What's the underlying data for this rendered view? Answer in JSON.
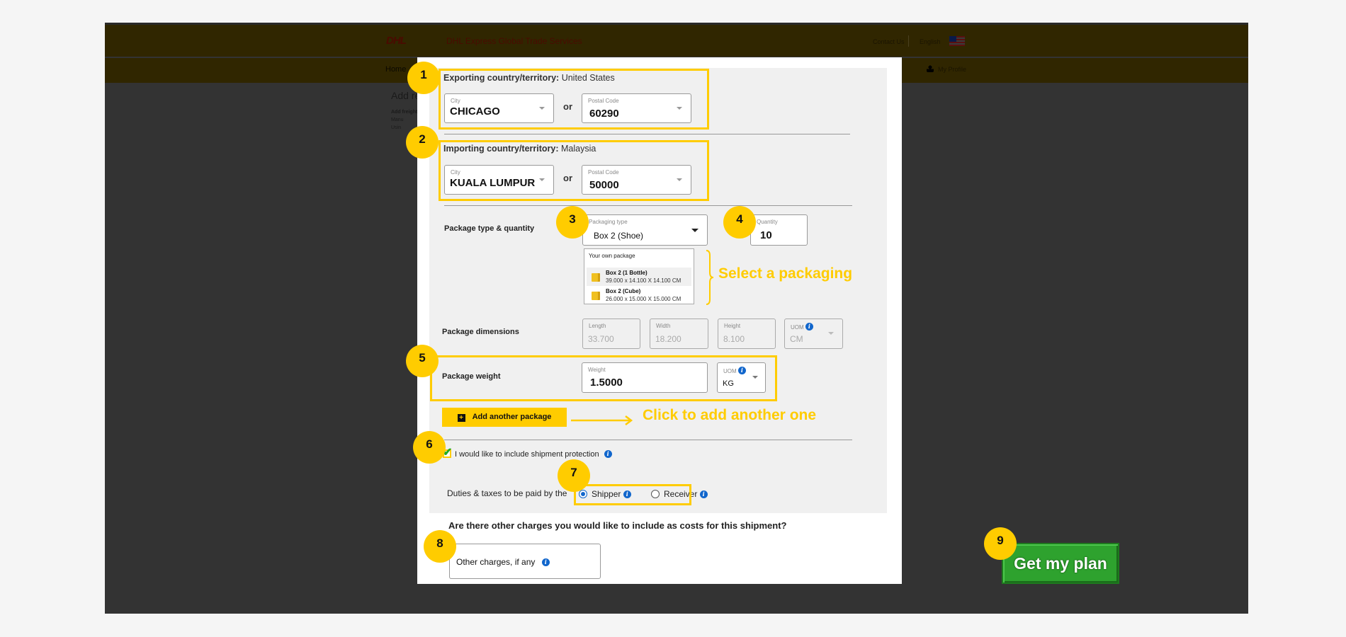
{
  "header": {
    "logo": "DHL",
    "brand_title": "DHL Express Global Trade Services",
    "contact_us": "Contact Us",
    "language": "English",
    "flag_icon": "malaysia-flag-icon",
    "nav_home": "Home",
    "my_profile": "My Profile"
  },
  "background_page": {
    "title": "Add re",
    "subtitle": "Add freight",
    "options": [
      "Manu",
      "Usin"
    ]
  },
  "exporting": {
    "label": "Exporting country/territory:",
    "country": "United States",
    "city_label": "City",
    "city_value": "CHICAGO",
    "or": "or",
    "postal_label": "Postal Code",
    "postal_value": "60290"
  },
  "importing": {
    "label": "Importing country/territory:",
    "country": "Malaysia",
    "city_label": "City",
    "city_value": "KUALA LUMPUR",
    "or": "or",
    "postal_label": "Postal Code",
    "postal_value": "50000"
  },
  "package": {
    "type_quantity_label": "Package type & quantity",
    "packaging_type_label": "Packaging type",
    "packaging_type_value": "Box 2 (Shoe)",
    "quantity_label": "Quantity",
    "quantity_value": "10",
    "dropdown_options": [
      {
        "name": "Your own package",
        "dims": ""
      },
      {
        "name": "Box 2 (1 Bottle)",
        "dims": "39.000 x 14.100 X 14.100 CM"
      },
      {
        "name": "Box 2 (Cube)",
        "dims": "26.000 x 15.000 X 15.000 CM"
      }
    ],
    "dimensions_label": "Package dimensions",
    "length_label": "Length",
    "length_value": "33.700",
    "width_label": "Width",
    "width_value": "18.200",
    "height_label": "Height",
    "height_value": "8.100",
    "dim_uom_label": "UOM",
    "dim_uom_value": "CM",
    "weight_row_label": "Package weight",
    "weight_label": "Weight",
    "weight_value": "1.5000",
    "weight_uom_label": "UOM",
    "weight_uom_value": "KG",
    "add_button": "Add another package"
  },
  "protection": {
    "checked": true,
    "label": "I would like to include shipment protection"
  },
  "duties": {
    "label": "Duties & taxes to be paid by the",
    "options": [
      {
        "label": "Shipper",
        "selected": true
      },
      {
        "label": "Receiver",
        "selected": false
      }
    ]
  },
  "other_charges": {
    "question": "Are there other charges you would like to include as costs for this shipment?",
    "field_label": "Other charges, if any"
  },
  "annotations": {
    "select_packaging": "Select a packaging",
    "add_another": "Click to add another one",
    "badges": [
      "1",
      "2",
      "3",
      "4",
      "5",
      "6",
      "7",
      "8",
      "9"
    ],
    "color": "#ffcc00"
  },
  "cta": {
    "label": "Get my plan",
    "color": "#2ea22e"
  }
}
